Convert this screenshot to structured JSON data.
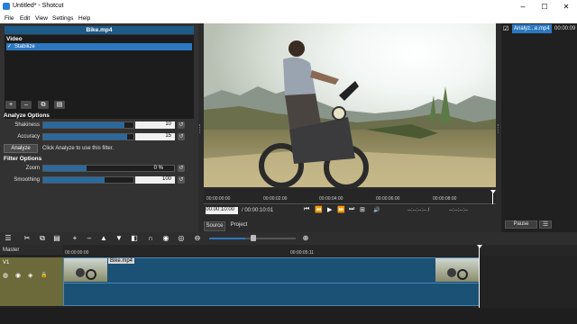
{
  "window": {
    "title": "Untitled* - Shotcut",
    "min": "–",
    "max": "☐",
    "close": "✕"
  },
  "menu": [
    "File",
    "Edit",
    "View",
    "Settings",
    "Help"
  ],
  "filters": {
    "header": "Bike.mp4",
    "section_video": "Video",
    "item_check": "✓",
    "item_name": "Stabilize",
    "btn_add": "+",
    "btn_remove": "–",
    "btn_copy": "⧉",
    "btn_paste": "▤",
    "analysis_title": "Analyze Options",
    "shakiness_label": "Shakiness",
    "shakiness_value": "10",
    "shakiness_fraction": 0.9,
    "accuracy_label": "Accuracy",
    "accuracy_value": "15",
    "accuracy_fraction": 0.93,
    "analyze_button": "Analyze",
    "analyze_hint": "Click Analyze to use this filter.",
    "filter_title": "Filter Options",
    "zoom_label": "Zoom",
    "zoom_value": "0 %",
    "zoom_fraction": 0.33,
    "smoothing_label": "Smoothing",
    "smoothing_value": "100",
    "smoothing_fraction": 0.68,
    "reset_icon": "↺"
  },
  "player": {
    "ticks": [
      "00:00:00:00",
      "00:00:02:00",
      "00:00:04:00",
      "00:00:06:00",
      "00:00:08:00"
    ],
    "position": "00:00:10:00",
    "duration": "/ 00:00:10:01",
    "in_out_left": "--:--:--:-- /",
    "in_out_right": "--:--:--:--",
    "btn_skip_start": "⏮",
    "btn_rewind": "⏪",
    "btn_play": "▶",
    "btn_forward": "⏩",
    "btn_skip_end": "⏭",
    "btn_grid": "⊞",
    "btn_volume": "🔊",
    "tab_source": "Source",
    "tab_project": "Project"
  },
  "playlist": {
    "item_check": "☑",
    "item_name": "Analyz...e.mp4",
    "item_time": "00:00:09",
    "pause_button": "Pause",
    "menu_button": "☰"
  },
  "toolbar": {
    "menu": "☰",
    "cut": "✂",
    "copy": "⧉",
    "paste": "▤",
    "add": "+",
    "remove": "–",
    "lift": "▲",
    "overwrite": "▼",
    "split": "◧",
    "snap": "∩",
    "scrub": "◉",
    "ripple": "◎",
    "zoom_out": "⊖",
    "zoom_in": "⊕",
    "zoom_level": 0.42
  },
  "timeline": {
    "master": "Master",
    "ruler_start": "00:00:00:00",
    "ruler_mid": "00:00:05:11",
    "track": "V1",
    "clip_name": "Bike.mp4",
    "icon_mute": "◍",
    "icon_hide": "◉",
    "icon_composite": "◈",
    "icon_lock": "🔒"
  }
}
